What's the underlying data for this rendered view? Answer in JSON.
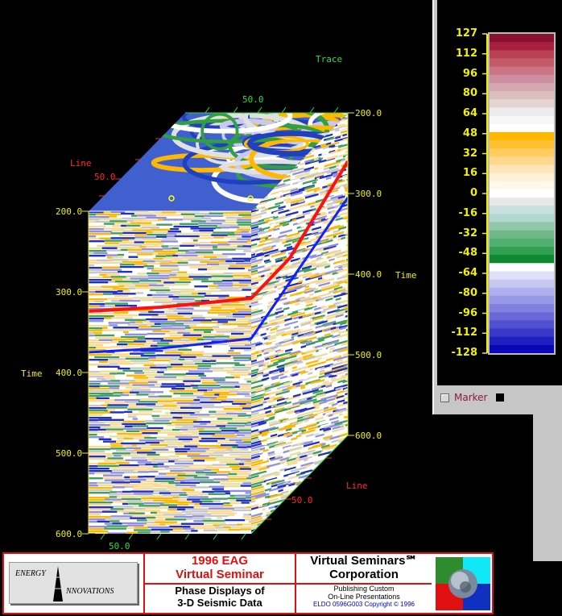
{
  "cube": {
    "title_trace": "Trace",
    "title_line_top": "Line",
    "title_line_right": "Line",
    "title_time_left": "Time",
    "title_time_right": "Time",
    "top_trace_tick": "50.0",
    "top_line_tick": "50.0",
    "left_time_ticks": [
      "200.0",
      "300.0",
      "400.0",
      "500.0",
      "600.0"
    ],
    "right_time_ticks": [
      "200.0",
      "300.0",
      "400.0",
      "500.0",
      "600.0"
    ],
    "bottom_trace_tick": "50.0",
    "right_line_tick": "50.0",
    "colors": {
      "horizon_red": "#ff1010",
      "horizon_blue": "#1020ff",
      "axis_yellow": "#f0f000",
      "axis_green": "#30e030",
      "axis_red": "#ff2a2a"
    }
  },
  "colorbar": {
    "labels": [
      "127",
      "112",
      "96",
      "80",
      "64",
      "48",
      "32",
      "16",
      "0",
      "-16",
      "-32",
      "-48",
      "-64",
      "-80",
      "-96",
      "-112",
      "-128"
    ],
    "marker_label": "Marker",
    "swatches": [
      "#8a1030",
      "#a8203f",
      "#b84050",
      "#c45a66",
      "#cc7482",
      "#cc8ea0",
      "#d4a8b0",
      "#dcc0c0",
      "#e4d4d4",
      "#ececec",
      "#f6f6f6",
      "#ffffff",
      "#ffb800",
      "#ffc030",
      "#ffcc60",
      "#ffd890",
      "#ffe4b8",
      "#fff0d8",
      "#fff8ea",
      "#ffffff",
      "#e8e8e8",
      "#c8e0e0",
      "#b0d8d0",
      "#90c8a8",
      "#70b888",
      "#50b070",
      "#30a050",
      "#108830",
      "#ffffff",
      "#e0e0f8",
      "#c8c8f0",
      "#b0b0f0",
      "#9898e8",
      "#8080e0",
      "#6868d8",
      "#5050d0",
      "#3838c8",
      "#2020c0",
      "#0808b8"
    ]
  },
  "footer": {
    "logo_word1": "ENERGY",
    "logo_word2": "NNOVATIONS",
    "eag_line1": "1996 EAG",
    "eag_line2": "Virtual Seminar",
    "phase_line1": "Phase Displays of",
    "phase_line2": "3-D Seismic Data",
    "vs_line1": "Virtual Seminars℠",
    "vs_line2": "Corporation",
    "pub_line1": "Publishing Custom",
    "pub_line2": "On-Line Presentations",
    "copyright": "ELDO 0596G003 Copyright © 1996",
    "colors": {
      "border": "#e01010",
      "badge_tl": "#2e8b2e",
      "badge_tr": "#10e8f8",
      "badge_bl": "#e01010",
      "badge_br": "#1030c0"
    }
  }
}
